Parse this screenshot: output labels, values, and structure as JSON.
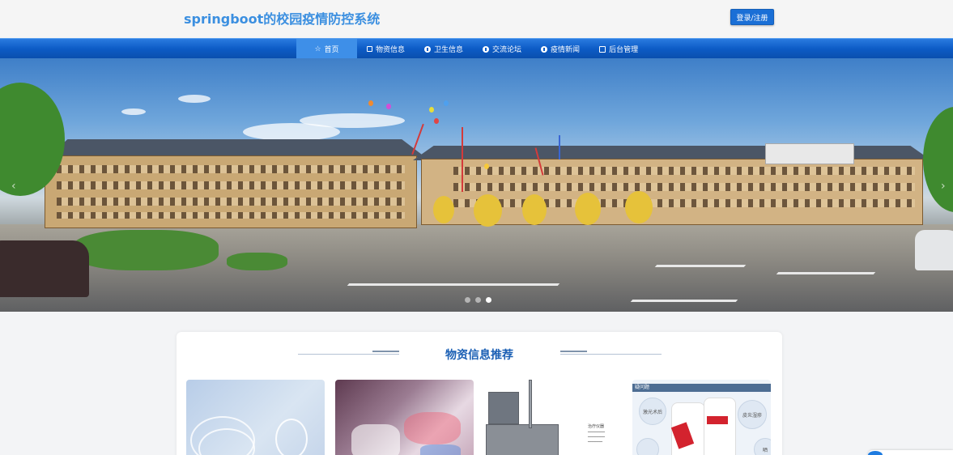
{
  "header": {
    "site_title": "springboot的校园疫情防控系统",
    "login_label": "登录/注册"
  },
  "nav": {
    "items": [
      {
        "label": "首页",
        "icon": "star-icon",
        "active": true
      },
      {
        "label": "物资信息",
        "icon": "bag-icon",
        "active": false
      },
      {
        "label": "卫生信息",
        "icon": "info-circle-icon",
        "active": false
      },
      {
        "label": "交流论坛",
        "icon": "info-circle-icon",
        "active": false
      },
      {
        "label": "疫情新闻",
        "icon": "info-circle-icon",
        "active": false
      },
      {
        "label": "后台管理",
        "icon": "box-icon",
        "active": false
      }
    ]
  },
  "banner": {
    "slide_count": 3,
    "active_slide": 3
  },
  "recommend": {
    "title": "物资信息推荐",
    "items": [
      {
        "name": "oxygen-mask-image"
      },
      {
        "name": "medical-supplies-image"
      },
      {
        "name": "medical-device-image",
        "caption": "治疗仪器"
      },
      {
        "name": "skin-care-image",
        "header": "疑问题",
        "tags": [
          "激光术后",
          "皮炎湿疹",
          "晒"
        ]
      }
    ]
  },
  "colors": {
    "accent": "#1a6fd6",
    "title_blue": "#3b8fe0",
    "nav_blue": "#0d5cc6",
    "section_title": "#1a5fb4"
  }
}
